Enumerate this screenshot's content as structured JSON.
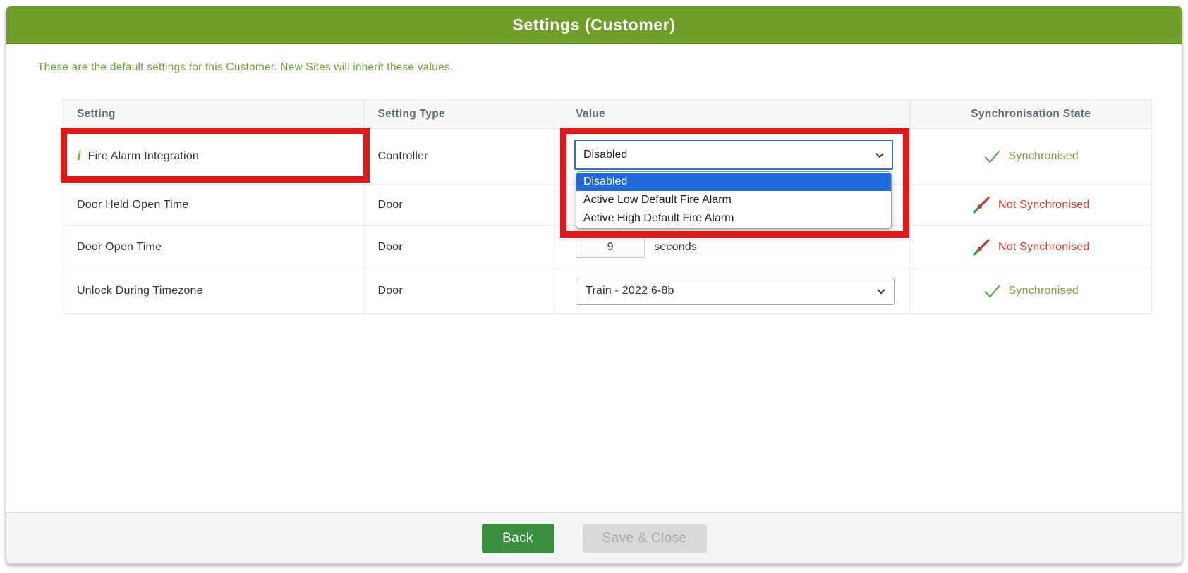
{
  "header": {
    "title": "Settings (Customer)"
  },
  "subtitle": "These are the default settings for this Customer. New Sites will inherit these values.",
  "table": {
    "columns": [
      "Setting",
      "Setting Type",
      "Value",
      "Synchronisation State"
    ],
    "rows": [
      {
        "setting": "Fire Alarm Integration",
        "type": "Controller",
        "value": "Disabled",
        "options": [
          "Disabled",
          "Active Low Default Fire Alarm",
          "Active High Default Fire Alarm"
        ],
        "selected_option": "Disabled",
        "sync": "Synchronised"
      },
      {
        "setting": "Door Held Open Time",
        "type": "Door",
        "sync": "Not Synchronised"
      },
      {
        "setting": "Door Open Time",
        "type": "Door",
        "value": "9",
        "unit": "seconds",
        "sync": "Not Synchronised"
      },
      {
        "setting": "Unlock During Timezone",
        "type": "Door",
        "value": "Train - 2022 6-8b",
        "sync": "Synchronised"
      }
    ]
  },
  "footer": {
    "back_label": "Back",
    "save_label": "Save & Close"
  },
  "icons": {
    "info": "i"
  },
  "colors": {
    "titlebar_green": "#6F9E29",
    "subtitle_green": "#71A03A",
    "synchronised_green": "#7AA23E",
    "check_green": "#4FA449",
    "not_synchronised_red": "#E0352B",
    "annotation_red": "#DE1B1B",
    "back_button_green": "#388E3C",
    "option_highlight_blue": "#1F6AD8",
    "select_focus_blue": "#2D6FC2"
  }
}
